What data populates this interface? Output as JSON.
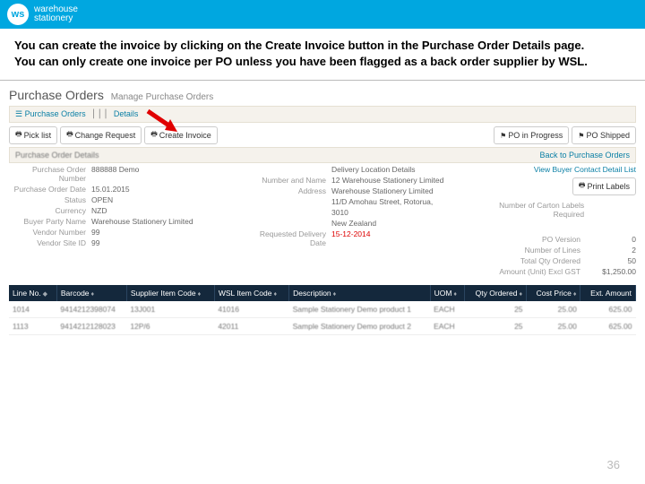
{
  "brand": {
    "abbrev": "ws",
    "name_line1": "warehouse",
    "name_line2": "stationery"
  },
  "instructions": {
    "line1": "You can create the invoice by clicking on the Create Invoice button in the Purchase Order Details page.",
    "line2": "You can only create one invoice per PO unless you have been flagged as a back order supplier by WSL."
  },
  "page_title": {
    "main": "Purchase Orders",
    "sub": "Manage Purchase Orders"
  },
  "breadcrumb": {
    "item1": "Purchase Orders",
    "item2": "Details",
    "icon": "☰"
  },
  "toolbar": {
    "pick_list": "Pick list",
    "change_request": "Change Request",
    "create_invoice": "Create Invoice",
    "po_in_progress": "PO in Progress",
    "po_shipped": "PO Shipped"
  },
  "details_header": {
    "title": "Purchase Order Details",
    "back_link": "Back to Purchase Orders"
  },
  "left": {
    "po_number_label": "Purchase Order Number",
    "po_number": "888888 Demo",
    "po_date_label": "Purchase Order Date",
    "po_date": "15.01.2015",
    "status_label": "Status",
    "status": "OPEN",
    "currency_label": "Currency",
    "currency": "NZD",
    "buyer_label": "Buyer Party Name",
    "buyer": "Warehouse Stationery Limited",
    "vendor_num_label": "Vendor Number",
    "vendor_num": "99",
    "vendor_site_label": "Vendor Site ID",
    "vendor_site": "99"
  },
  "mid": {
    "loc_header": "Delivery Location Details",
    "num_name_label": "Number and Name",
    "num_name": "12 Warehouse Stationery Limited",
    "address_label": "Address",
    "addr1": "Warehouse Stationery Limited",
    "addr2": "11/D Amohau Street, Rotorua,",
    "addr3": "3010",
    "addr4": "New Zealand",
    "req_date_label": "Requested Delivery Date",
    "req_date": "15-12-2014"
  },
  "right": {
    "view_contact": "View Buyer Contact Detail List",
    "print_labels": "Print Labels",
    "carton_label": "Number of Carton Labels Required",
    "po_version_label": "PO Version",
    "po_version": "0",
    "num_lines_label": "Number of Lines",
    "num_lines": "2",
    "qty_label": "Total Qty Ordered",
    "qty": "50",
    "amount_label": "Amount (Unit) Excl GST",
    "amount": "$1,250.00"
  },
  "table": {
    "headers": {
      "line": "Line No.",
      "barcode": "Barcode",
      "supplier_code": "Supplier Item Code",
      "wsl_code": "WSL Item Code",
      "desc": "Description",
      "uom": "UOM",
      "qty": "Qty Ordered",
      "cost": "Cost Price",
      "ext": "Ext. Amount"
    },
    "rows": [
      {
        "line": "1014",
        "barcode": "9414212398074",
        "supplier_code": "13J001",
        "wsl_code": "41016",
        "desc": "Sample Stationery Demo product 1",
        "uom": "EACH",
        "qty": "25",
        "cost": "25.00",
        "ext": "625.00"
      },
      {
        "line": "1113",
        "barcode": "9414212128023",
        "supplier_code": "12P/6",
        "wsl_code": "42011",
        "desc": "Sample Stationery Demo product 2",
        "uom": "EACH",
        "qty": "25",
        "cost": "25.00",
        "ext": "625.00"
      }
    ]
  },
  "page_number": "36"
}
